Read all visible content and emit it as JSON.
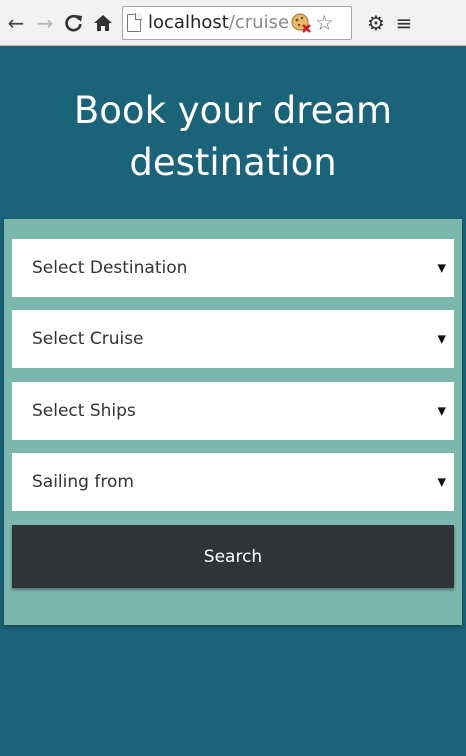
{
  "browser": {
    "url_host": "localhost",
    "url_path": "/cruise",
    "icons": [
      "back-arrow-icon",
      "forward-arrow-icon",
      "reload-icon",
      "home-icon",
      "page-icon",
      "cookie-blocked-icon",
      "bookmark-star-icon",
      "settings-gear-icon",
      "menu-icon"
    ]
  },
  "page": {
    "heading": "Book your dream destination"
  },
  "form": {
    "destination_label": "Select Destination",
    "cruise_label": "Select Cruise",
    "ships_label": "Select Ships",
    "sailing_label": "Sailing from",
    "search_label": "Search"
  },
  "colors": {
    "page_bg": "#1a6378",
    "panel_bg": "#7cb7ae",
    "button_bg": "#2f3536"
  }
}
